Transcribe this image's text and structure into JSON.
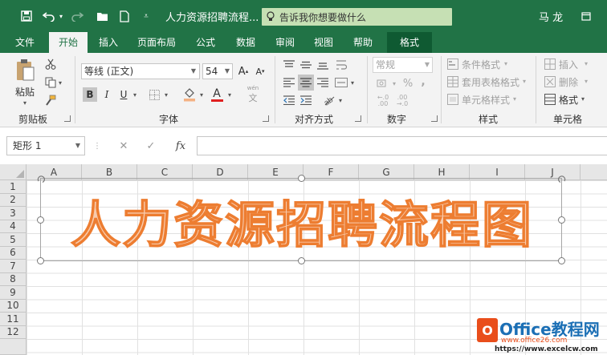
{
  "titlebar": {
    "title": "人力资源招聘流程...",
    "search_placeholder": "告诉我你想要做什么",
    "user": "马 龙",
    "icons": [
      "save-icon",
      "undo-icon",
      "redo-icon",
      "open-folder-icon",
      "new-file-icon",
      "customize-qat-icon",
      "lightbulb-icon",
      "restore-window-icon"
    ]
  },
  "tabs": [
    "文件",
    "开始",
    "插入",
    "页面布局",
    "公式",
    "数据",
    "审阅",
    "视图",
    "帮助",
    "格式"
  ],
  "active_tab": "开始",
  "ribbon": {
    "clipboard": {
      "paste": "粘贴",
      "label": "剪贴板"
    },
    "font": {
      "name": "等线 (正文)",
      "size": "54",
      "bold": "B",
      "italic": "I",
      "underline": "U",
      "grow": "A",
      "shrink": "A",
      "text_color_letter": "A",
      "phonetic": "wén",
      "label": "字体"
    },
    "alignment": {
      "label": "对齐方式"
    },
    "number": {
      "format": "常规",
      "percent": "%",
      "comma": ",",
      "label": "数字"
    },
    "styles": {
      "conditional": "条件格式",
      "table_style": "套用表格格式",
      "cell_style": "单元格样式",
      "label": "样式"
    },
    "cells": {
      "insert": "插入",
      "delete": "删除",
      "format": "格式",
      "label": "单元格"
    }
  },
  "formula_bar": {
    "name_box": "矩形 1",
    "fx": "fx",
    "formula": ""
  },
  "grid": {
    "columns": [
      "A",
      "B",
      "C",
      "D",
      "E",
      "F",
      "G",
      "H",
      "I",
      "J"
    ],
    "rows": [
      "1",
      "2",
      "3",
      "4",
      "5",
      "6",
      "7",
      "8",
      "9",
      "10",
      "11",
      "12"
    ]
  },
  "shape": {
    "text": "人力资源招聘流程图",
    "fill_color": "#f8cbad",
    "outline_color": "#ed7d31"
  },
  "watermark": {
    "brand": "Office教程网",
    "url1": "www.office26.com",
    "url2": "https://www.excelcw.com"
  },
  "colors": {
    "accent": "#217346",
    "accent_dark": "#0f5a32",
    "search_bg": "#c6e0b4"
  }
}
